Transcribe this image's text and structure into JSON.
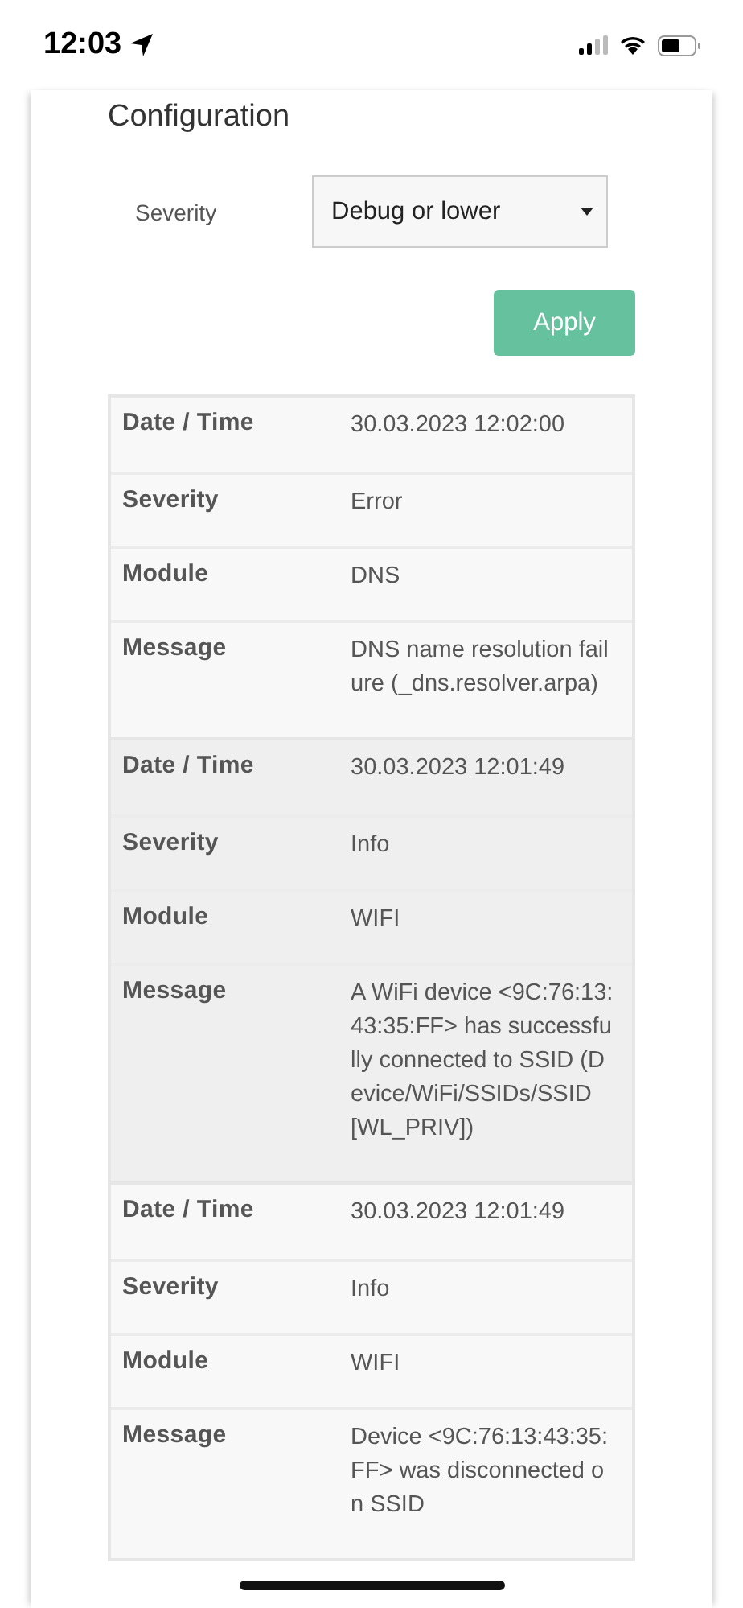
{
  "status_bar": {
    "time": "12:03"
  },
  "configuration": {
    "title": "Configuration",
    "severity_label": "Severity",
    "severity_select": {
      "value": "Debug or lower"
    },
    "apply_button": "Apply"
  },
  "log_entries": [
    {
      "fields": [
        {
          "label": "Date / Time",
          "value": "30.03.2023 12:02:00"
        },
        {
          "label": "Severity",
          "value": "Error"
        },
        {
          "label": "Module",
          "value": "DNS"
        },
        {
          "label": "Message",
          "value": "DNS name resolution failure (_dns.resolver.arpa)"
        }
      ]
    },
    {
      "fields": [
        {
          "label": "Date / Time",
          "value": "30.03.2023 12:01:49"
        },
        {
          "label": "Severity",
          "value": "Info"
        },
        {
          "label": "Module",
          "value": "WIFI"
        },
        {
          "label": "Message",
          "value": "A WiFi device <9C:76:13:43:35:FF> has successfully connected to SSID (Device/WiFi/SSIDs/SSID[WL_PRIV])"
        }
      ]
    },
    {
      "fields": [
        {
          "label": "Date / Time",
          "value": "30.03.2023 12:01:49"
        },
        {
          "label": "Severity",
          "value": "Info"
        },
        {
          "label": "Module",
          "value": "WIFI"
        },
        {
          "label": "Message",
          "value": "Device <9C:76:13:43:35:FF> was disconnected on SSID"
        }
      ]
    }
  ]
}
